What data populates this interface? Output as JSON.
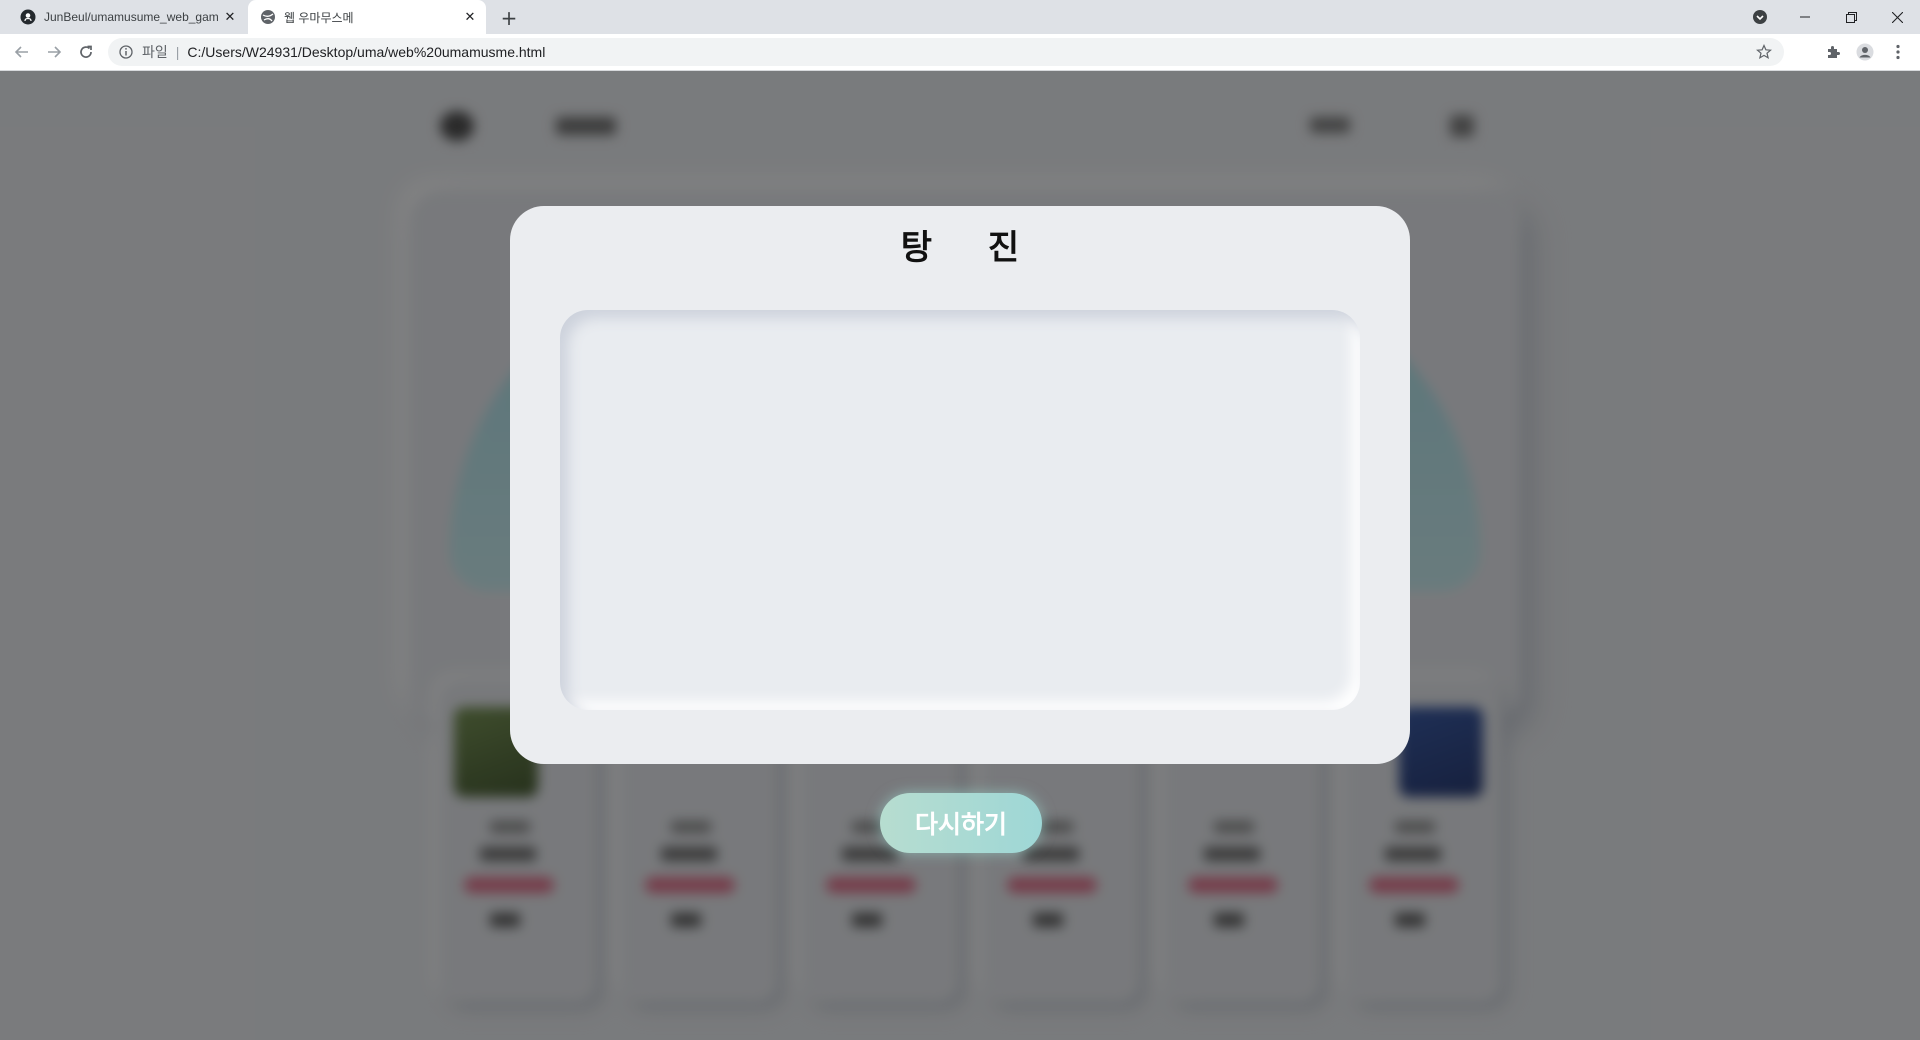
{
  "browser": {
    "tabs": [
      {
        "title": "JunBeul/umamusume_web_gam",
        "favicon": "github-icon",
        "active": false
      },
      {
        "title": "웹 우마무스메",
        "favicon": "globe-icon",
        "active": true
      }
    ],
    "address": {
      "scheme_label": "파일",
      "url": "C:/Users/W24931/Desktop/uma/web%20umamusme.html"
    }
  },
  "modal": {
    "title": "탕 진",
    "retry_label": "다시하기"
  },
  "colors": {
    "page_background": "#e9ecf0",
    "overlay": "#7b7c7e",
    "modal_background": "#ebedf0",
    "retry_button_gradient": [
      "#b7ddd0",
      "#9ed7d6"
    ]
  }
}
